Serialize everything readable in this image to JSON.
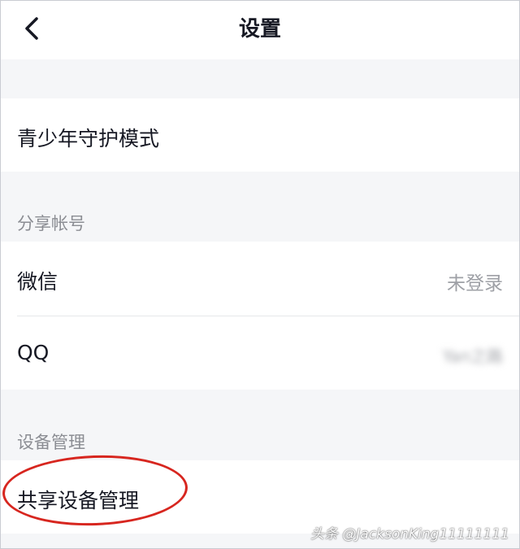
{
  "header": {
    "title": "设置"
  },
  "rows": {
    "teen_mode": {
      "label": "青少年守护模式"
    },
    "wechat": {
      "label": "微信",
      "value": "未登录"
    },
    "qq": {
      "label": "QQ",
      "value": "Yan之路"
    },
    "shared_devices": {
      "label": "共享设备管理"
    }
  },
  "sections": {
    "share_accounts": "分享帐号",
    "device_management": "设备管理"
  },
  "watermark": "头条 @JacksonKing11111111",
  "colors": {
    "background": "#f5f6f8",
    "card": "#ffffff",
    "primary_text": "#161823",
    "secondary_text": "#9ea0a6",
    "annotation_red": "#d7261f"
  },
  "icons": {
    "back": "chevron-left-icon"
  }
}
